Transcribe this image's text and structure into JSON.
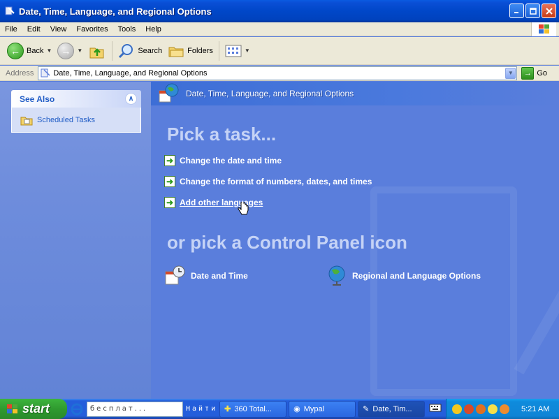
{
  "window": {
    "title": "Date, Time, Language, and Regional Options",
    "buttons": [
      "minimize",
      "maximize",
      "close"
    ]
  },
  "menubar": {
    "items": [
      "File",
      "Edit",
      "View",
      "Favorites",
      "Tools",
      "Help"
    ]
  },
  "toolbar": {
    "back_label": "Back",
    "search_label": "Search",
    "folders_label": "Folders"
  },
  "address": {
    "label": "Address",
    "value": "Date, Time, Language, and Regional Options",
    "go_label": "Go"
  },
  "leftpane": {
    "see_also_title": "See Also",
    "links": [
      "Scheduled Tasks"
    ]
  },
  "main": {
    "header_title": "Date, Time, Language, and Regional Options",
    "pick_task": "Pick a task...",
    "tasks": [
      "Change the date and time",
      "Change the format of numbers, dates, and times",
      "Add other languages"
    ],
    "or_pick": "or pick a Control Panel icon",
    "icons": [
      "Date and Time",
      "Regional and Language Options"
    ]
  },
  "taskbar": {
    "start_label": "start",
    "search_text": "бесплат...",
    "find_label": "Найти",
    "tasks": [
      "360 Total...",
      "Mypal",
      "Date, Tim..."
    ],
    "time": "5:21 AM"
  },
  "colors": {
    "pane_blue": "#5a7edc",
    "link_blue": "#215dc6",
    "title_blue": "#0047c8",
    "start_green": "#2f9a2f"
  }
}
